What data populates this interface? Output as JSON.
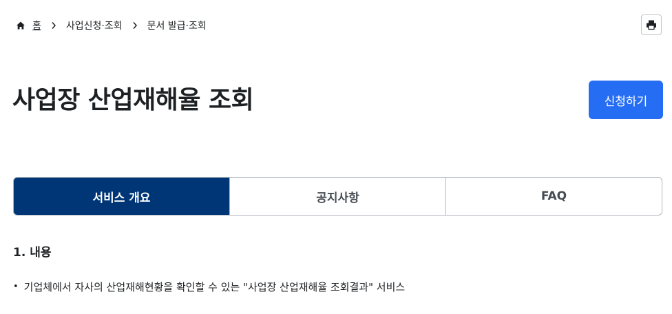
{
  "breadcrumb": {
    "home": "홈",
    "items": [
      "사업신청·조회",
      "문서 발급·조회"
    ]
  },
  "page": {
    "title": "사업장 산업재해율 조회",
    "apply_label": "신청하기"
  },
  "tabs": [
    {
      "label": "서비스 개요",
      "active": true
    },
    {
      "label": "공지사항",
      "active": false
    },
    {
      "label": "FAQ",
      "active": false
    }
  ],
  "content": {
    "heading": "1. 내용",
    "bullets": [
      "기업체에서 자사의 산업재해현황을 확인할 수 있는 \"사업장 산업재해율 조회결과\" 서비스"
    ]
  },
  "colors": {
    "primary_button": "#256ef4",
    "active_tab": "#003675"
  },
  "icons": {
    "home": "home-icon",
    "separator": "chevron-right-icon",
    "print": "printer-icon"
  }
}
